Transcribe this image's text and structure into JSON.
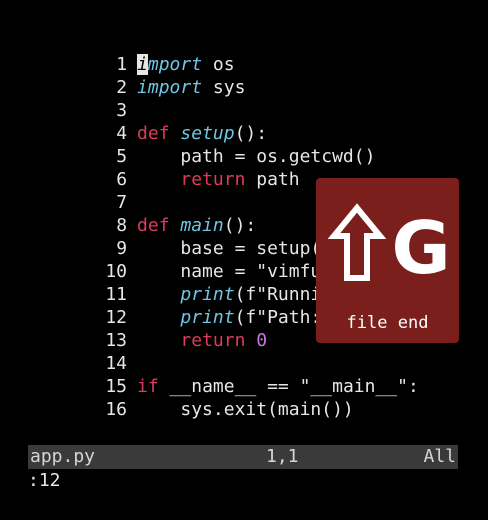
{
  "editor": {
    "lines": [
      {
        "n": "1"
      },
      {
        "n": "2"
      },
      {
        "n": "3"
      },
      {
        "n": "4"
      },
      {
        "n": "5"
      },
      {
        "n": "6"
      },
      {
        "n": "7"
      },
      {
        "n": "8"
      },
      {
        "n": "9"
      },
      {
        "n": "10"
      },
      {
        "n": "11"
      },
      {
        "n": "12"
      },
      {
        "n": "13"
      },
      {
        "n": "14"
      },
      {
        "n": "15"
      },
      {
        "n": "16"
      }
    ],
    "tokens": {
      "l1_cursor": "i",
      "l1_rest": "mport",
      "l1_mod": " os",
      "l2_kw": "import",
      "l2_mod": " sys",
      "l4_def": "def",
      "l4_name": "setup",
      "l4_rest": "():",
      "l5": "    path = os.getcwd()",
      "l6_indent": "    ",
      "l6_ret": "return",
      "l6_rest": " path",
      "l8_def": "def",
      "l8_name": "main",
      "l8_rest": "():",
      "l9": "    base = setup()",
      "l10": "    name = \"vimfu\"",
      "l11_indent": "    ",
      "l11_fn": "print",
      "l11_rest": "(f\"Running {na",
      "l12_indent": "    ",
      "l12_fn": "print",
      "l12_rest": "(f\"Path: {base",
      "l13_indent": "    ",
      "l13_ret": "return",
      "l13_num": " 0",
      "l15_if": "if",
      "l15_rest": " __name__ == \"__main__\":",
      "l16": "    sys.exit(main())"
    }
  },
  "statusbar": {
    "filename": "app.py",
    "position": "1,1",
    "scroll": "All"
  },
  "cmdline": {
    "text": ":12"
  },
  "overlay": {
    "key_letter": "G",
    "icon": "shift-arrow-up-icon",
    "label": "file end",
    "background": "#7a1f1c"
  },
  "colors": {
    "background": "#000000",
    "keyword": "#e03a5a",
    "function": "#6fc6e3",
    "number": "#c678dd",
    "statusbar": "#3a3a3a"
  }
}
